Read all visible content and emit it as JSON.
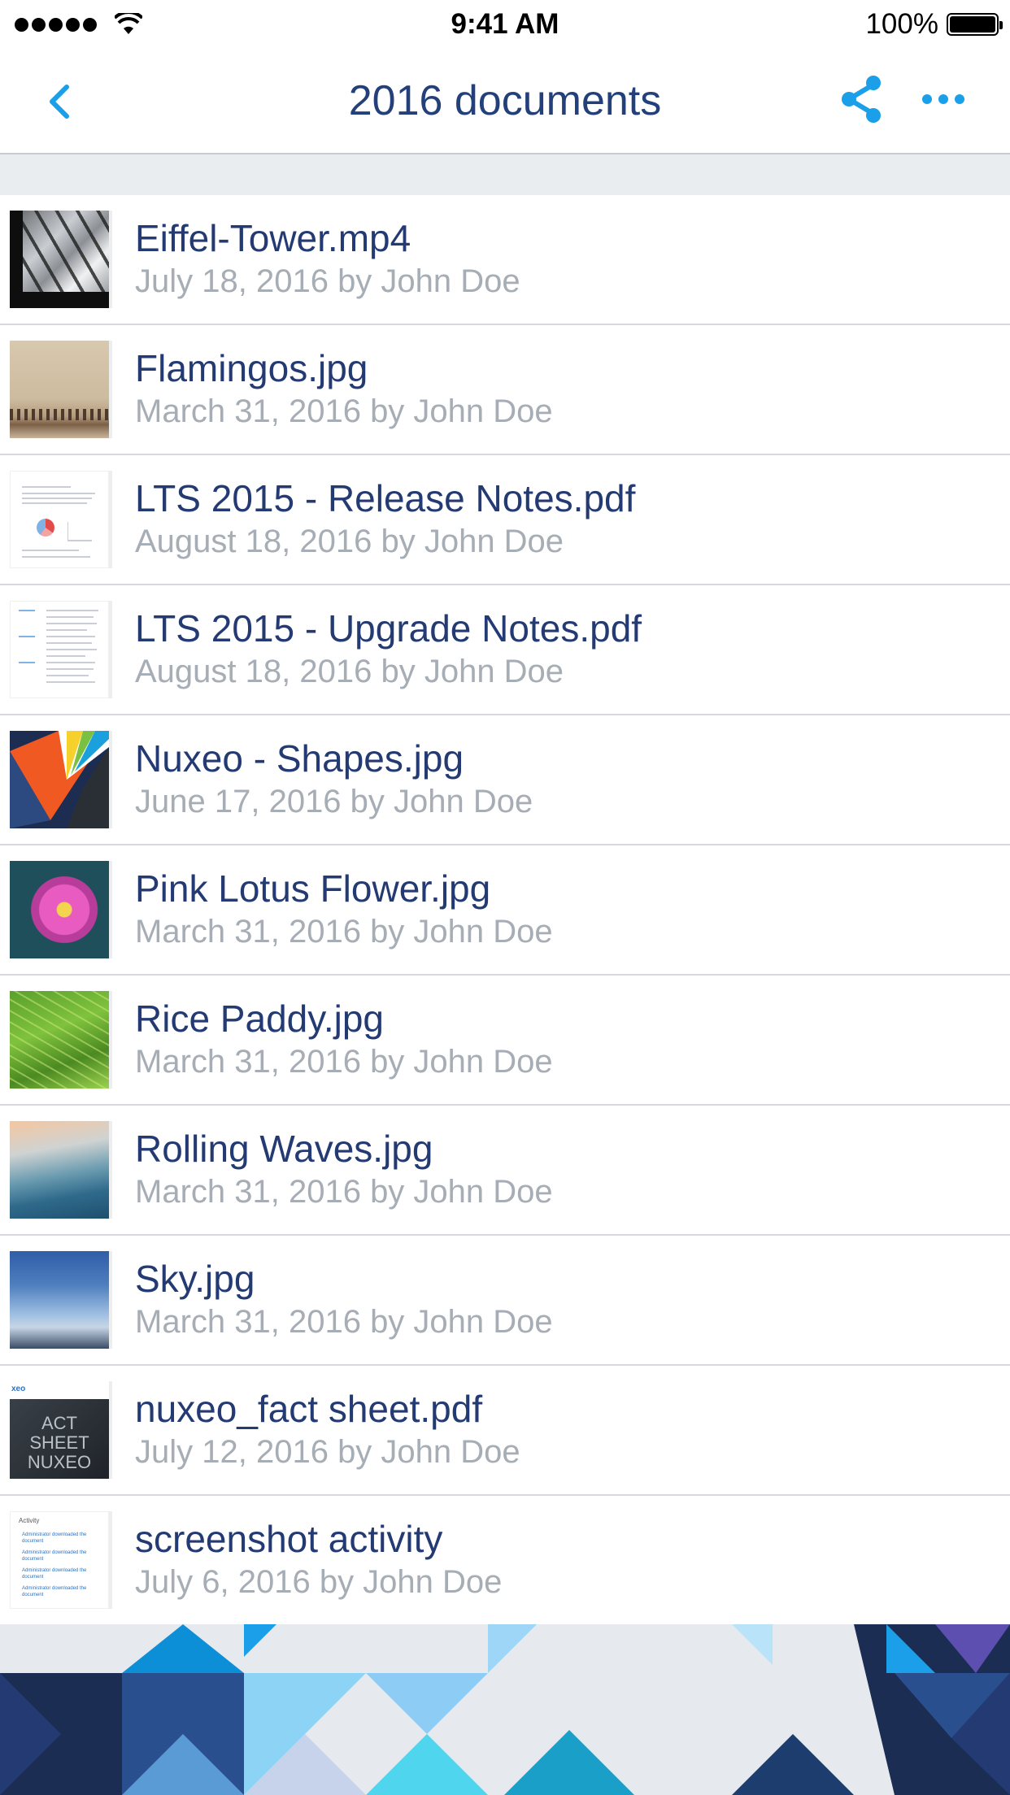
{
  "status_bar": {
    "time": "9:41 AM",
    "battery": "100%",
    "signal_icon": "signal-dots-icon",
    "wifi_icon": "wifi-icon",
    "battery_icon": "battery-icon"
  },
  "nav": {
    "title": "2016 documents",
    "back_icon": "chevron-left-icon",
    "share_icon": "share-icon",
    "more_icon": "more-icon"
  },
  "colors": {
    "accent": "#1a9fe8",
    "title_text": "#243a72",
    "meta_text": "#a6adb5",
    "band": "#e9edf0"
  },
  "documents": [
    {
      "name": "Eiffel-Tower.mp4",
      "meta": "July 18, 2016 by John Doe",
      "thumb": "eiffel"
    },
    {
      "name": "Flamingos.jpg",
      "meta": "March 31, 2016 by John Doe",
      "thumb": "flamingo"
    },
    {
      "name": "LTS 2015 - Release Notes.pdf",
      "meta": "August 18, 2016 by John Doe",
      "thumb": "doc-release"
    },
    {
      "name": "LTS 2015 - Upgrade Notes.pdf",
      "meta": "August 18, 2016 by John Doe",
      "thumb": "doc-upgrade"
    },
    {
      "name": "Nuxeo - Shapes.jpg",
      "meta": "June 17, 2016 by John Doe",
      "thumb": "shapes"
    },
    {
      "name": "Pink Lotus Flower.jpg",
      "meta": "March 31, 2016 by John Doe",
      "thumb": "lotus"
    },
    {
      "name": "Rice Paddy.jpg",
      "meta": "March 31, 2016 by John Doe",
      "thumb": "rice"
    },
    {
      "name": "Rolling Waves.jpg",
      "meta": "March 31, 2016 by John Doe",
      "thumb": "waves"
    },
    {
      "name": "Sky.jpg",
      "meta": "March 31, 2016 by John Doe",
      "thumb": "sky"
    },
    {
      "name": "nuxeo_fact sheet.pdf",
      "meta": "July 12, 2016 by John Doe",
      "thumb": "fact"
    },
    {
      "name": "screenshot activity",
      "meta": "July 6, 2016 by John Doe",
      "thumb": "activity"
    }
  ],
  "thumb_text": {
    "fact_tag": "xeo",
    "fact_line1": "ACT SHEET",
    "fact_line2": "NUXEO",
    "activity_title": "Activity",
    "activity_entry": "Administrator downloaded the document"
  }
}
